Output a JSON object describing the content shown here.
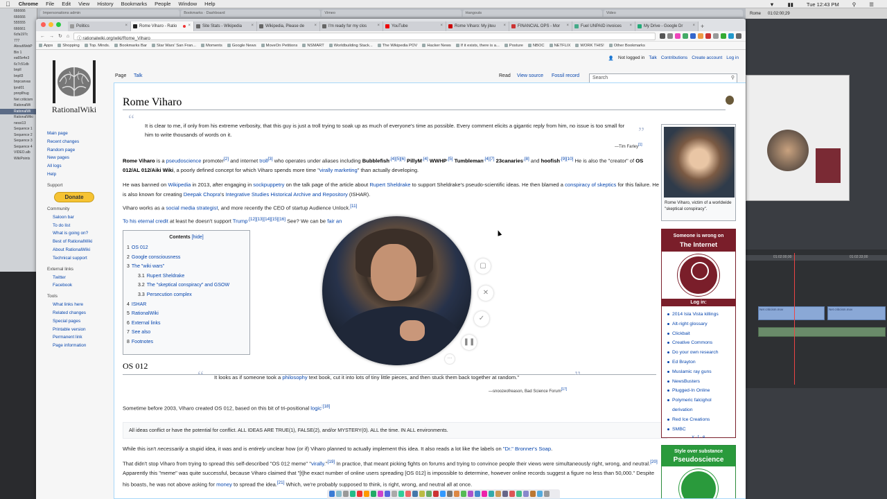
{
  "mac": {
    "apple": "",
    "app": "Chrome",
    "menus": [
      "File",
      "Edit",
      "View",
      "History",
      "Bookmarks",
      "People",
      "Window",
      "Help"
    ],
    "clock": "Tue 12:43 PM"
  },
  "left_panel": {
    "items": [
      "666666",
      "666666",
      "555555",
      "666661",
      "6cfa197c",
      "777",
      "AboutWebP",
      "Bin 1",
      "ea65e4e3",
      "6c7c51db",
      "bnpll",
      "bnpll3",
      "bnpcanvas",
      "lpnd01",
      "pnnpllhug",
      "Net criticism",
      "RationalWi",
      "RationalWi",
      "RationalWiki",
      "nessi13",
      "Sequence 1",
      "Sequence 2",
      "Sequence 3",
      "Sequence 4",
      "VIDEO.alb",
      "WikiPoints"
    ],
    "selected_index": 17
  },
  "right_app": {
    "tab": "Rome",
    "timecode1": "01:02:00;29",
    "timecode2": "01:02:00;00",
    "timecode3": "01:02:33;00",
    "clip1": "Net criticism.mov",
    "clip2": "Net criticism.mov"
  },
  "tabs": [
    {
      "label": "Politics",
      "color": "#999"
    },
    {
      "label": "Rome Viharo - Ratio",
      "color": "#222",
      "active": true,
      "recording": true
    },
    {
      "label": "Site Stats - Wikipedia",
      "color": "#666"
    },
    {
      "label": "Wikipedia, Please de",
      "color": "#666"
    },
    {
      "label": "I'm ready for my clos",
      "color": "#666"
    },
    {
      "label": "YouTube",
      "color": "#e00"
    },
    {
      "label": "Rome Viharo: My jiteu",
      "color": "#c00"
    },
    {
      "label": "FINANCIAL OPS - Mor",
      "color": "#c33"
    },
    {
      "label": "Fuel UNPAID invoices",
      "color": "#4a8"
    },
    {
      "label": "My Drive - Google Dr",
      "color": "#2a7"
    }
  ],
  "url": "rationalwiki.org/wiki/Rome_Viharo",
  "bookmarks": [
    "Apps",
    "Shopping",
    "Top. Minds.",
    "Bookmarks Bar",
    "Star Wars' San Fran...",
    "Moments",
    "Google News",
    "MoveOn Petitions",
    "NSMART",
    "Worldbuilding Stack...",
    "The Wikipedia POV",
    "Hacker News",
    "If it exists, there is a...",
    "Posture",
    "NBOC",
    "NETFLIX",
    "WORK THIS!",
    "Other Bookmarks"
  ],
  "wiki": {
    "logo_text": "RationalWiki",
    "page_tab": "Page",
    "talk_tab": "Talk",
    "read_tab": "Read",
    "source_tab": "View source",
    "fossil_tab": "Fossil record",
    "search_placeholder": "Search",
    "user_links": [
      "Not logged in",
      "Talk",
      "Contributions",
      "Create account",
      "Log in"
    ],
    "nav_main": [
      "Main page",
      "Recent changes",
      "Random page",
      "New pages",
      "All logs",
      "Help"
    ],
    "support_heading": "Support",
    "donate": "Donate",
    "community_heading": "Community",
    "nav_community": [
      "Saloon bar",
      "To do list",
      "What is going on?",
      "Best of RationalWiki",
      "About RationalWiki",
      "Technical support"
    ],
    "external_heading": "External links",
    "nav_external": [
      "Twitter",
      "Facebook"
    ],
    "tools_heading": "Tools",
    "nav_tools": [
      "What links here",
      "Related changes",
      "Special pages",
      "Printable version",
      "Permanent link",
      "Page information"
    ],
    "title": "Rome Viharo",
    "quote1": "It is clear to me, if only from his extreme verbosity, that this guy is just a troll trying to soak up as much of everyone's time as possible. Every comment elicits a gigantic reply from him, no issue is too small for him to write thousands of words on it.",
    "quote1_attr": "—Tim Farley",
    "quote1_ref": "[1]",
    "para1": {
      "name": "Rome Viharo",
      "t1": " is a ",
      "pseudoscience": "pseudoscience",
      "t2": " promoter",
      "ref2": "[2]",
      "t3": " and internet ",
      "troll": "troll",
      "ref3": "[3]",
      "t4": " who operates under aliases including ",
      "a1": "Bubblefish",
      "ref4": ",[4][5][6]",
      "a2": " PillyM",
      "ref5": ",[4]",
      "a3": " WWHP",
      "ref6": ",[5]",
      "a4": " Tumbleman",
      "ref7": ",[4][7]",
      "a5": " 23canaries",
      "ref8": ",[8]",
      "t5": " and ",
      "a6": "hoofish",
      "ref9": ".[9][10]",
      "t6": " He is also the \"creator\" of ",
      "os": "OS 012/AL 012/Aiki Wiki",
      "t7": ", a poorly defined concept for which Viharo spends more time \"",
      "viral": "virally marketing",
      "t8": "\" than actually developing."
    },
    "para2": {
      "t1": "He was banned on ",
      "wikipedia": "Wikipedia",
      "t2": " in 2013, after engaging in ",
      "sock": "sockpuppetry",
      "t3": " on the talk page of the article about ",
      "rupert": "Rupert Sheldrake",
      "t4": " to support Sheldrake's pseudo-scientific ideas. He then blamed a ",
      "consp": "conspiracy of skeptics",
      "t5": " for this failure. He is also known for creating ",
      "deepak": "Deepak Chopra",
      "t6": "'s ",
      "isha": "Integrative Studies Historical Archive and Repository",
      "t7": " (ISHAR)."
    },
    "para3": {
      "t1": "Viharo works as a ",
      "sms": "social media strategist",
      "t2": ", and more recently the CEO of startup Audience Unlock.",
      "ref": "[11]"
    },
    "para4": {
      "eternal": "To his eternal credit",
      "t1": " at least he doesn't support ",
      "trump": "Trump",
      "ref": ".[12][13][14][15][16]",
      "t2": " See? We can be ",
      "fair": "fair an"
    },
    "toc": {
      "title": "Contents",
      "hide": "[hide]",
      "items": [
        {
          "n": "1",
          "label": "OS 012",
          "sub": false
        },
        {
          "n": "2",
          "label": "Google consciousness",
          "sub": false
        },
        {
          "n": "3",
          "label": "The \"wiki wars\"",
          "sub": false
        },
        {
          "n": "3.1",
          "label": "Rupert Sheldrake",
          "sub": true
        },
        {
          "n": "3.2",
          "label": "The \"skeptical conspiracy\" and GSOW",
          "sub": true
        },
        {
          "n": "3.3",
          "label": "Persecution complex",
          "sub": true
        },
        {
          "n": "4",
          "label": "ISHAR",
          "sub": false
        },
        {
          "n": "5",
          "label": "RationalWiki",
          "sub": false
        },
        {
          "n": "6",
          "label": "External links",
          "sub": false
        },
        {
          "n": "7",
          "label": "See also",
          "sub": false
        },
        {
          "n": "8",
          "label": "Footnotes",
          "sub": false
        }
      ]
    },
    "h2": "OS 012",
    "quote2_pre": "It looks as if someone took a ",
    "quote2_link": "philosophy",
    "quote2_post": " text book, cut it into lots of tiny little pieces, and then stuck them back together at random.\"",
    "quote2_attr": "—snoozeofreason, Bad Science Forum",
    "quote2_ref": "[17]",
    "para5": {
      "t1": "Sometime before 2003, Viharo created OS 012, based on this bit of tri-positional ",
      "logic": "logic",
      "ref": ":[18]"
    },
    "pre": "All ideas conflict or have the potential for conflict. ALL IDEAS ARE TRUE(1), FALSE(2), and/or MYSTERY(0). ALL the time. IN ALL environments.",
    "para6": {
      "t1": "While this isn't ",
      "nec": "necessarily",
      "t2": " a stupid idea, it was and is ",
      "ent": "entirely",
      "t3": " unclear how (or if) Viharo planned to actually implement this idea. It also reads a lot like the labels on ",
      "bronner": "\"Dr.\" Bronner's Soap",
      "t4": "."
    },
    "para7": {
      "t1": "That didn't stop Viharo from trying to spread this self-described \"OS 012 meme\" \"",
      "viral": "virally",
      "t2": ".\"",
      "ref19": "[19]",
      "t3": " In practice, that meant picking fights on forums and trying to convince people their views were simultaneously right, wrong, and neutral.",
      "ref20": "[20]",
      "t4": " Apparently this \"meme\" was quite successful, because Viharo claimed that \"[t]he exact number of online users spreading [OS 012] is impossible to determine, however online records suggest a figure no less than 50,000.\" Despite his boasts, he was not above asking for ",
      "money": "money",
      "t5": " to spread the idea.",
      "ref21": "[21]",
      "t6": " Which, we're probably supposed to think, is right, wrong, and neutral all at once."
    },
    "infobox_caption": "Rome Viharo, victim of a worldwide \"skeptical conspiracy\".",
    "wrong": {
      "line1": "Someone is wrong on",
      "line2": "The Internet",
      "login": "Log in:",
      "items": [
        "2014 Isla Vista killings",
        "Alt-right glossary",
        "Clickbait",
        "Creative Commons",
        "Do your own research",
        "Ed Brayton",
        "Muslamic ray guns",
        "NewsBusters",
        "Plugged-In Online",
        "Polymeric falcighol derivation",
        "Red Ice Creations",
        "SMBC"
      ],
      "vte": "v · t · e"
    },
    "pseudo": {
      "line1": "Style over substance",
      "line2": "Pseudoscience"
    }
  },
  "colors": {
    "link": "#0645ad",
    "wrong": "#7a1e2a",
    "pseudo": "#2a9a3c",
    "donate": "#f6c333"
  }
}
